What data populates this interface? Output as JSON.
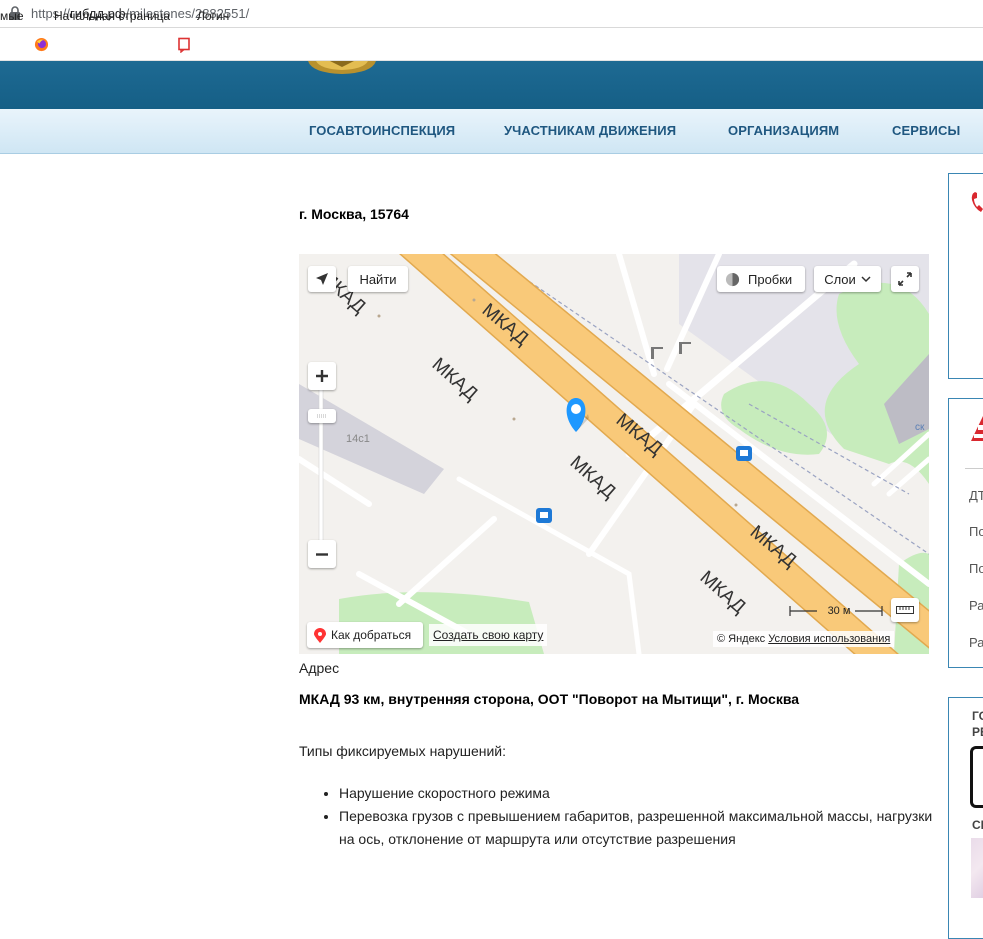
{
  "browser": {
    "url_prefix": "https://",
    "url_host": "гибдд.рф",
    "url_path": "/milestones/2882551/",
    "bookmarks": [
      {
        "label": "мые"
      },
      {
        "label": "Начальная страница"
      },
      {
        "label": "Логин"
      }
    ]
  },
  "nav": {
    "items": [
      "ГОСАВТОИНСПЕКЦИЯ",
      "УЧАСТНИКАМ ДВИЖЕНИЯ",
      "ОРГАНИЗАЦИЯМ",
      "СЕРВИСЫ"
    ]
  },
  "page": {
    "title": "г. Москва, 15764",
    "address_label": "Адрес",
    "address_value": "МКАД 93 км, внутренняя сторона, ООТ \"Поворот на Мытищи\", г. Москва",
    "violations_label": "Типы фиксируемых нарушений:",
    "violations": [
      "Нарушение скоростного режима",
      "Перевозка грузов с превышением габаритов, разрешенной максимальной массы, нагрузки на ось, отклонение от маршрута или отсутствие разрешения"
    ]
  },
  "map": {
    "find_label": "Найти",
    "traffic_label": "Пробки",
    "layers_label": "Слои",
    "road_label": "МКАД",
    "building_label": "14с1",
    "scale_label": "30 м",
    "route_label": "Как добраться",
    "create_map_label": "Создать свою карту",
    "copyright": "© Яндекс",
    "terms_label": "Условия использования",
    "edge_label": "ск"
  },
  "sidebar": {
    "items": [
      "ДТ",
      "По",
      "По",
      "Ра",
      "Ра"
    ],
    "card3_line1": "ГО",
    "card3_line2": "РЕ",
    "card3_line3": "СЕ"
  },
  "colors": {
    "road": "#f9c979",
    "road_edge": "#e2a94f",
    "header": "#1b658d",
    "nav_text": "#1f5780",
    "pin": "#1e98ff",
    "accent_red": "#d9282f"
  }
}
